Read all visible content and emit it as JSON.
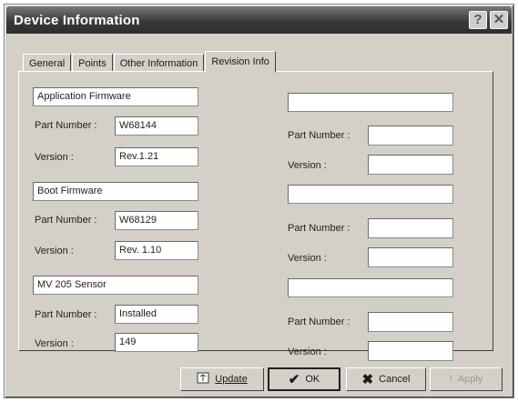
{
  "window": {
    "title": "Device Information",
    "help_glyph": "?",
    "close_glyph": "✕"
  },
  "tabs": [
    {
      "label": "General"
    },
    {
      "label": "Points"
    },
    {
      "label": "Other Information"
    },
    {
      "label": "Revision Info"
    }
  ],
  "left_groups": [
    {
      "name": "Application Firmware",
      "part_label": "Part Number :",
      "part_value": "W68144",
      "version_label": "Version :",
      "version_value": "Rev.1.21"
    },
    {
      "name": "Boot Firmware",
      "part_label": "Part Number :",
      "part_value": "W68129",
      "version_label": "Version :",
      "version_value": "Rev. 1.10"
    },
    {
      "name": "MV 205 Sensor",
      "part_label": "Part Number :",
      "part_value": "Installed",
      "version_label": "Version :",
      "version_value": "149"
    }
  ],
  "right_groups": [
    {
      "name": "",
      "part_label": "Part Number :",
      "part_value": "",
      "version_label": "Version :",
      "version_value": ""
    },
    {
      "name": "",
      "part_label": "Part Number :",
      "part_value": "",
      "version_label": "Version :",
      "version_value": ""
    },
    {
      "name": "",
      "part_label": "Part Number :",
      "part_value": "",
      "version_label": "Version :",
      "version_value": ""
    }
  ],
  "buttons": {
    "update": {
      "label": "Update",
      "icon": "update-icon"
    },
    "ok": {
      "label": "OK",
      "icon": "checkmark-icon"
    },
    "cancel": {
      "label": "Cancel",
      "icon": "x-icon"
    },
    "apply": {
      "label": "Apply",
      "icon": "apply-icon",
      "disabled": true
    }
  }
}
